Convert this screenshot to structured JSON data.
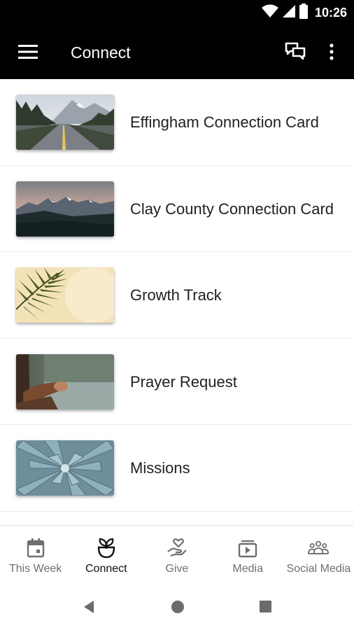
{
  "status_bar": {
    "time": "10:26",
    "icons": [
      "wifi-icon",
      "signal-icon",
      "battery-icon"
    ]
  },
  "app_bar": {
    "title": "Connect",
    "icons": [
      "menu-icon",
      "chat-icon",
      "more-vert-icon"
    ]
  },
  "list": {
    "items": [
      {
        "label": "Effingham Connection Card",
        "image": "mountain-road-photo"
      },
      {
        "label": "Clay County Connection Card",
        "image": "mountain-range-photo"
      },
      {
        "label": "Growth Track",
        "image": "palm-leaf-photo"
      },
      {
        "label": "Prayer Request",
        "image": "folded-hands-photo"
      },
      {
        "label": "Missions",
        "image": "succulent-photo"
      }
    ]
  },
  "bottom_nav": {
    "items": [
      {
        "label": "This Week",
        "icon": "calendar-icon",
        "active": false
      },
      {
        "label": "Connect",
        "icon": "sprout-icon",
        "active": true
      },
      {
        "label": "Give",
        "icon": "heart-hand-icon",
        "active": false
      },
      {
        "label": "Media",
        "icon": "play-folder-icon",
        "active": false
      },
      {
        "label": "Social Media",
        "icon": "people-icon",
        "active": false
      }
    ]
  },
  "system_nav": {
    "icons": [
      "back-icon",
      "home-icon",
      "recents-icon"
    ]
  },
  "colors": {
    "app_bar": "#000000",
    "active_nav": "#111111",
    "inactive_nav": "#6f6f6f",
    "divider": "#ececec"
  }
}
